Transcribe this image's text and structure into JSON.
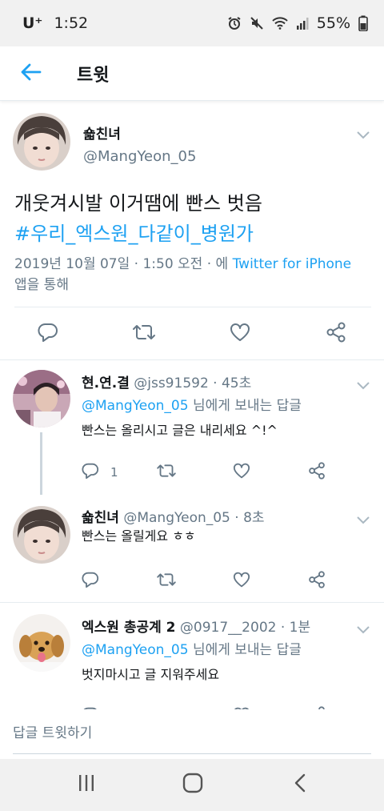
{
  "status_bar": {
    "carrier": "U⁺",
    "time": "1:52",
    "battery": "55%"
  },
  "header": {
    "title": "트윗",
    "back_icon": "arrow-left-icon"
  },
  "main_tweet": {
    "name": "숇친녀",
    "handle": "@MangYeon_05",
    "text": "개웃겨시발 이거땜에 빤스 벗음",
    "hashtag": "#우리_엑스원_다같이_병원가",
    "date": "2019년 10월 07일 · 1:50 오전 · 에 ",
    "source": "Twitter for iPhone",
    "suffix": "앱을 통해"
  },
  "replies": [
    {
      "name": "현.연.결",
      "handle": "@jss91592 · 45초",
      "reply_to_handle": "@MangYeon_05",
      "reply_to_suffix": " 님에게 보내는 답글",
      "text": "빤스는 올리시고 글은 내리세요 ^!^",
      "reply_count": "1"
    },
    {
      "name": "숇친녀",
      "handle": "@MangYeon_05 · 8초",
      "text": "빤스는 올릴게요 ㅎㅎ",
      "reply_count": ""
    },
    {
      "name": "엑스원 총공계 2",
      "handle": "@0917__2002 · 1분",
      "reply_to_handle": "@MangYeon_05",
      "reply_to_suffix": " 님에게 보내는 답글",
      "text": "벗지마시고 글 지워주세요"
    }
  ],
  "compose": {
    "placeholder": "답글 트윗하기"
  },
  "colors": {
    "accent": "#1da1f2",
    "secondary_text": "#657786",
    "divider": "#e6ecf0"
  },
  "icons": [
    "reply-icon",
    "retweet-icon",
    "like-icon",
    "share-icon",
    "caret-down-icon",
    "alarm-icon",
    "mute-icon",
    "wifi-icon",
    "signal-icon",
    "battery-icon",
    "recents-icon",
    "home-icon",
    "back-icon"
  ]
}
